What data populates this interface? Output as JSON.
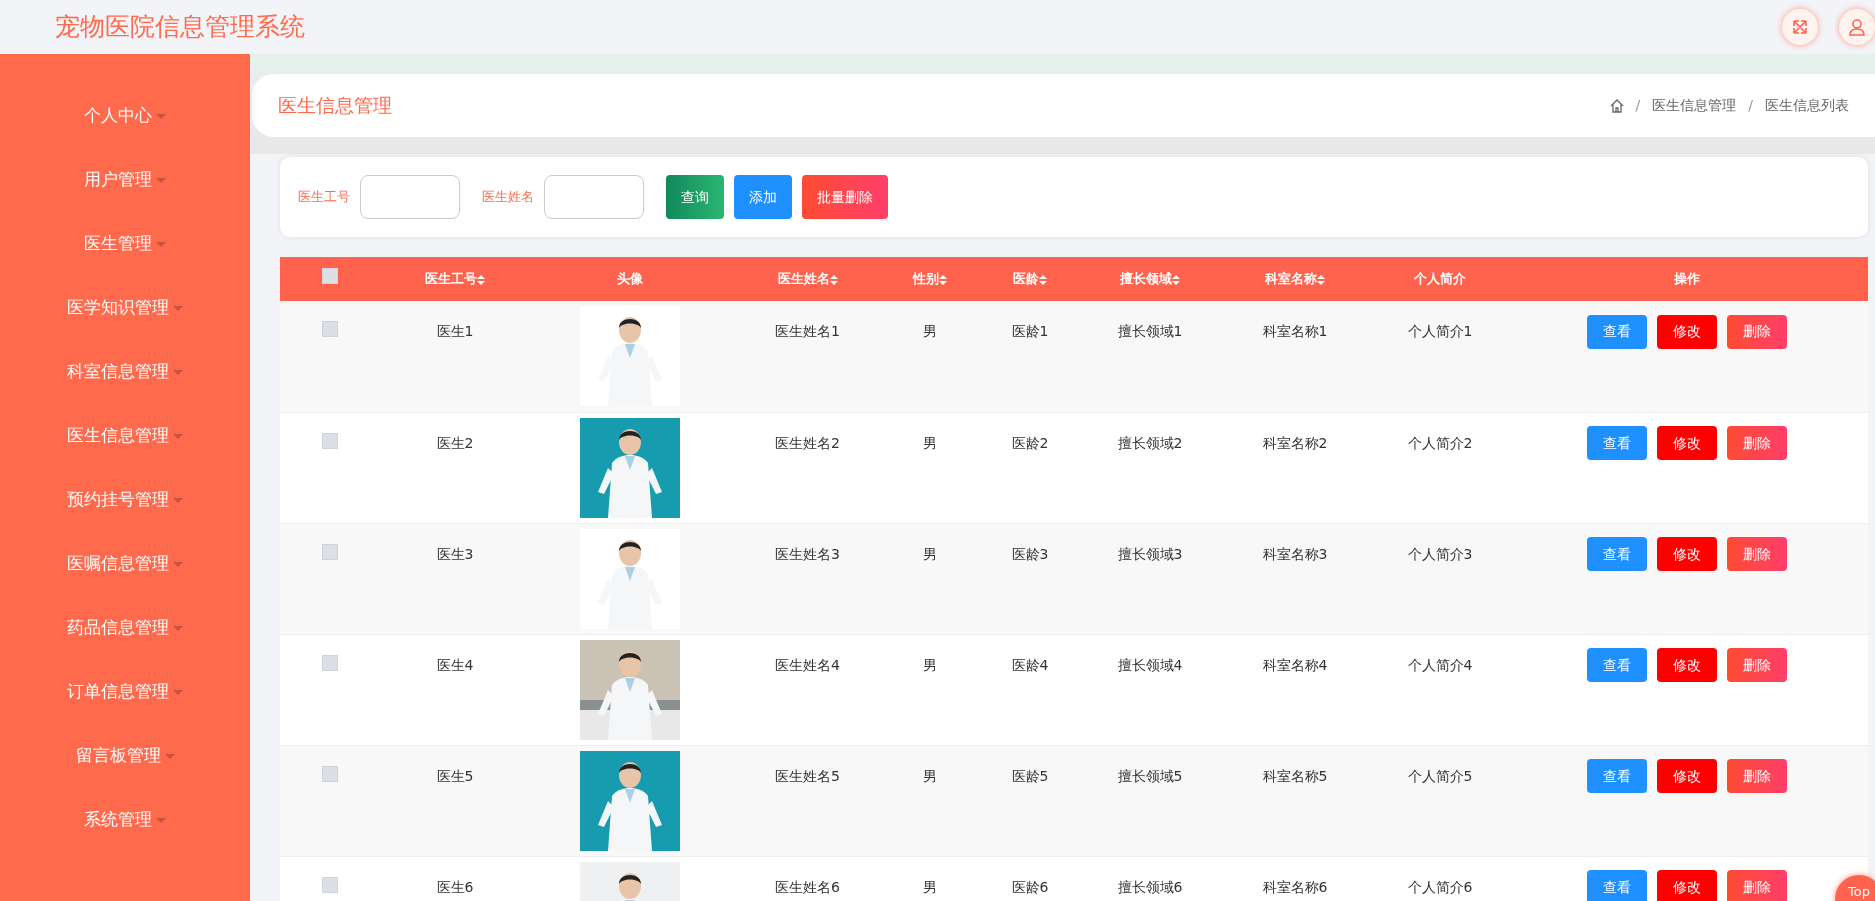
{
  "app_title": "宠物医院信息管理系统",
  "header_buttons": [
    {
      "kind": "fullscreen"
    },
    {
      "kind": "user"
    }
  ],
  "sidebar": {
    "items": [
      "个人中心",
      "用户管理",
      "医生管理",
      "医学知识管理",
      "科室信息管理",
      "医生信息管理",
      "预约挂号管理",
      "医嘱信息管理",
      "药品信息管理",
      "订单信息管理",
      "留言板管理",
      "系统管理"
    ]
  },
  "page_title": "医生信息管理",
  "breadcrumb": [
    {
      "kind": "separator",
      "text": "/"
    },
    {
      "kind": "item",
      "text": "医生信息管理"
    },
    {
      "kind": "separator",
      "text": "/"
    },
    {
      "kind": "item",
      "text": "医生信息列表"
    }
  ],
  "search": {
    "fields": [
      {
        "label": "医生工号"
      },
      {
        "label": "医生姓名"
      }
    ],
    "buttons": [
      {
        "label": "查询",
        "kind": "search"
      },
      {
        "label": "添加",
        "kind": "add"
      },
      {
        "label": "批量删除",
        "kind": "delete"
      }
    ]
  },
  "table": {
    "select_all_checked": false,
    "columns": [
      {
        "label": "医生工号",
        "sortable": true
      },
      {
        "label": "头像",
        "sortable": false
      },
      {
        "label": "医生姓名",
        "sortable": true
      },
      {
        "label": "性别",
        "sortable": true
      },
      {
        "label": "医龄",
        "sortable": true
      },
      {
        "label": "擅长领域",
        "sortable": true
      },
      {
        "label": "科室名称",
        "sortable": true
      },
      {
        "label": "个人简介",
        "sortable": false
      },
      {
        "label": "操作",
        "sortable": false
      }
    ],
    "rows": [
      {
        "checked": false,
        "cells": [
          "医生1",
          {
            "kind": "picture"
          },
          "医生姓名1",
          "男",
          "医龄1",
          "擅长领域1",
          "科室名称1",
          "个人简介1"
        ],
        "actions": [
          {
            "label": "查看",
            "kind": "view"
          },
          {
            "label": "修改",
            "kind": "edit"
          },
          {
            "label": "删除",
            "kind": "delete"
          }
        ]
      },
      {
        "checked": false,
        "cells": [
          "医生2",
          {
            "kind": "picture"
          },
          "医生姓名2",
          "男",
          "医龄2",
          "擅长领域2",
          "科室名称2",
          "个人简介2"
        ],
        "actions": [
          {
            "label": "查看",
            "kind": "view"
          },
          {
            "label": "修改",
            "kind": "edit"
          },
          {
            "label": "删除",
            "kind": "delete"
          }
        ]
      },
      {
        "checked": false,
        "cells": [
          "医生3",
          {
            "kind": "picture"
          },
          "医生姓名3",
          "男",
          "医龄3",
          "擅长领域3",
          "科室名称3",
          "个人简介3"
        ],
        "actions": [
          {
            "label": "查看",
            "kind": "view"
          },
          {
            "label": "修改",
            "kind": "edit"
          },
          {
            "label": "删除",
            "kind": "delete"
          }
        ]
      },
      {
        "checked": false,
        "cells": [
          "医生4",
          {
            "kind": "picture"
          },
          "医生姓名4",
          "男",
          "医龄4",
          "擅长领域4",
          "科室名称4",
          "个人简介4"
        ],
        "actions": [
          {
            "label": "查看",
            "kind": "view"
          },
          {
            "label": "修改",
            "kind": "edit"
          },
          {
            "label": "删除",
            "kind": "delete"
          }
        ]
      },
      {
        "checked": false,
        "cells": [
          "医生5",
          {
            "kind": "picture"
          },
          "医生姓名5",
          "男",
          "医龄5",
          "擅长领域5",
          "科室名称5",
          "个人简介5"
        ],
        "actions": [
          {
            "label": "查看",
            "kind": "view"
          },
          {
            "label": "修改",
            "kind": "edit"
          },
          {
            "label": "删除",
            "kind": "delete"
          }
        ]
      },
      {
        "checked": false,
        "cells": [
          "医生6",
          {
            "kind": "picture"
          },
          "医生姓名6",
          "男",
          "医龄6",
          "擅长领域6",
          "科室名称6",
          "个人简介6"
        ],
        "actions": [
          {
            "label": "查看",
            "kind": "view"
          },
          {
            "label": "修改",
            "kind": "edit"
          },
          {
            "label": "删除",
            "kind": "delete"
          }
        ]
      }
    ]
  },
  "back_to_top": "Top"
}
